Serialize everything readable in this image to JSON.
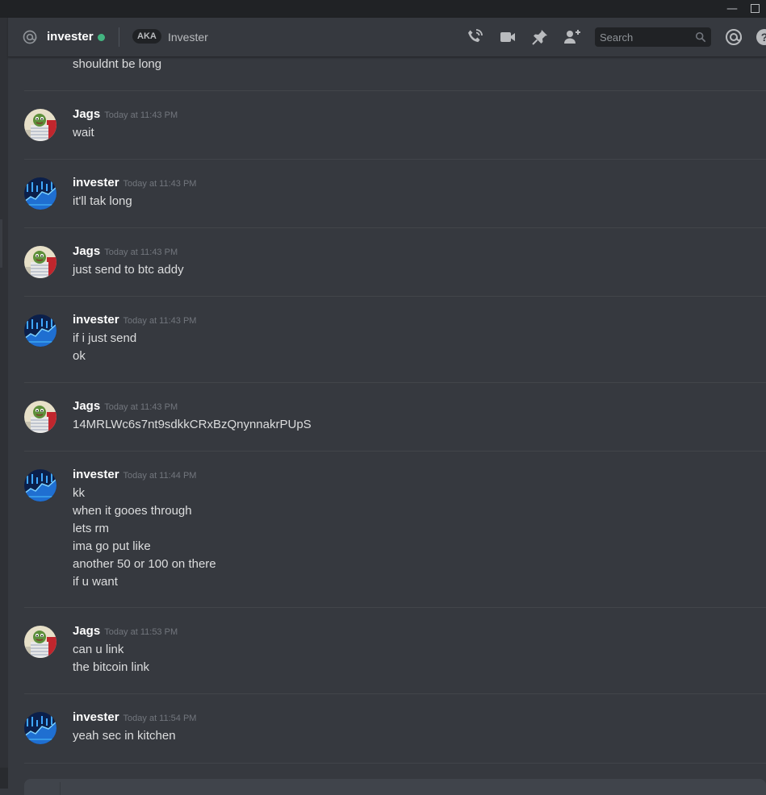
{
  "window": {
    "minimize_glyph": "—",
    "maximize_label": ""
  },
  "header": {
    "channel_icon": "at-icon",
    "name": "invester",
    "status_color": "#43b581",
    "aka_badge": "AKA",
    "alias": "Invester",
    "icons": [
      "start-voice-call-icon",
      "start-video-call-icon",
      "pinned-messages-icon",
      "add-friend-icon",
      "mentions-icon",
      "help-icon"
    ],
    "search": {
      "placeholder": "Search",
      "value": ""
    }
  },
  "messages": {
    "partial_top": {
      "lines": [
        "shouldnt be long"
      ]
    },
    "groups": [
      {
        "author": "Jags",
        "timestamp": "Today at 11:43 PM",
        "lines": [
          "wait"
        ],
        "avatar": "jags"
      },
      {
        "author": "invester",
        "timestamp": "Today at 11:43 PM",
        "lines": [
          "it'll tak long"
        ],
        "avatar": "invester"
      },
      {
        "author": "Jags",
        "timestamp": "Today at 11:43 PM",
        "lines": [
          "just send to btc addy"
        ],
        "avatar": "jags"
      },
      {
        "author": "invester",
        "timestamp": "Today at 11:43 PM",
        "lines": [
          "if i just send",
          "ok"
        ],
        "avatar": "invester"
      },
      {
        "author": "Jags",
        "timestamp": "Today at 11:43 PM",
        "lines": [
          "14MRLWc6s7nt9sdkkCRxBzQnynnakrPUpS"
        ],
        "avatar": "jags"
      },
      {
        "author": "invester",
        "timestamp": "Today at 11:44 PM",
        "lines": [
          "kk",
          "when it gooes through",
          "lets rm",
          "ima go put like",
          "another 50 or 100 on there",
          "if u want"
        ],
        "avatar": "invester"
      },
      {
        "author": "Jags",
        "timestamp": "Today at 11:53 PM",
        "lines": [
          "can u link",
          "the bitcoin link"
        ],
        "avatar": "jags"
      },
      {
        "author": "invester",
        "timestamp": "Today at 11:54 PM",
        "lines": [
          "yeah sec in kitchen"
        ],
        "avatar": "invester"
      }
    ]
  },
  "colors": {
    "background": "#36393f",
    "titlebar": "#202225",
    "text": "#dcddde",
    "author": "#ffffff",
    "timestamp": "#72767d",
    "online": "#43b581"
  }
}
